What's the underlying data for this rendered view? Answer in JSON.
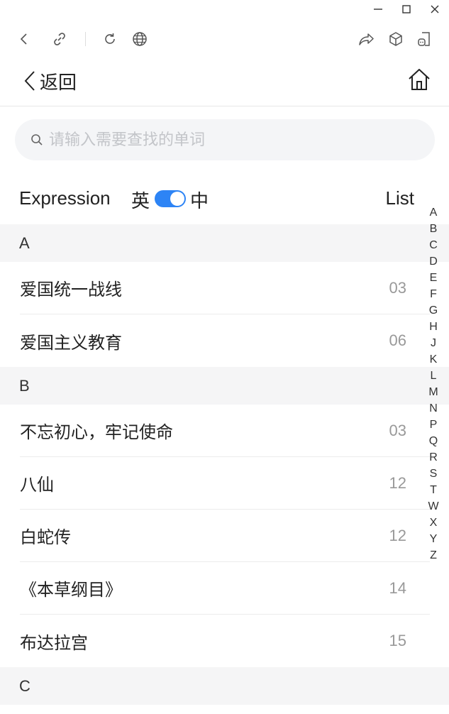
{
  "window": {
    "minimize_icon": "minimize-icon",
    "maximize_icon": "maximize-icon",
    "close_icon": "close-icon"
  },
  "browser_bar": {
    "icons": [
      "back-arrow-icon",
      "link-icon",
      "refresh-icon",
      "globe-icon",
      "share-icon",
      "cube-icon",
      "mini-program-icon"
    ]
  },
  "header": {
    "back_label": "返回",
    "home_icon": "home-icon"
  },
  "search": {
    "placeholder": "请输入需要查找的单词"
  },
  "filter": {
    "mode_label": "Expression",
    "lang_en": "英",
    "lang_zh": "中",
    "toggle_on": true,
    "list_label": "List"
  },
  "colors": {
    "accent": "#2d84f5",
    "section_bg": "#f5f5f6",
    "search_bg": "#f4f5f7",
    "count_text": "#999999"
  },
  "sections": [
    {
      "letter": "A",
      "items": [
        {
          "name": "爱国统一战线",
          "count": "03"
        },
        {
          "name": "爱国主义教育",
          "count": "06"
        }
      ]
    },
    {
      "letter": "B",
      "items": [
        {
          "name": "不忘初心，牢记使命",
          "count": "03"
        },
        {
          "name": "八仙",
          "count": "12"
        },
        {
          "name": "白蛇传",
          "count": "12"
        },
        {
          "name": "《本草纲目》",
          "count": "14"
        },
        {
          "name": "布达拉宫",
          "count": "15"
        }
      ]
    },
    {
      "letter": "C",
      "items": []
    }
  ],
  "alphabet": [
    "A",
    "B",
    "C",
    "D",
    "E",
    "F",
    "G",
    "H",
    "J",
    "K",
    "L",
    "M",
    "N",
    "P",
    "Q",
    "R",
    "S",
    "T",
    "W",
    "X",
    "Y",
    "Z"
  ]
}
